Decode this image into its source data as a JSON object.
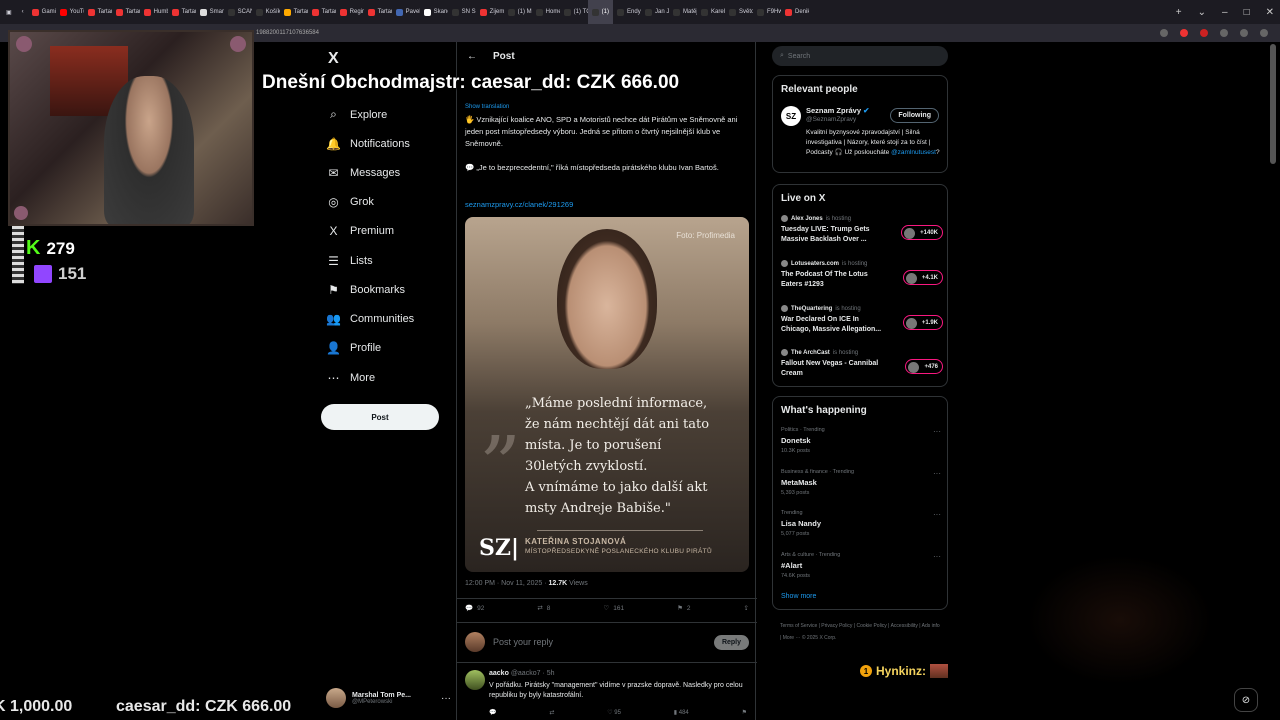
{
  "browser": {
    "tabs": [
      {
        "label": "Gami",
        "color": "#e33"
      },
      {
        "label": "YouTu",
        "color": "#f00"
      },
      {
        "label": "Tartar",
        "color": "#e33"
      },
      {
        "label": "Tartar",
        "color": "#e33"
      },
      {
        "label": "Humb",
        "color": "#e33"
      },
      {
        "label": "Tartar",
        "color": "#e33"
      },
      {
        "label": "Smart",
        "color": "#ddd"
      },
      {
        "label": "SCAN",
        "color": "#333"
      },
      {
        "label": "Košík",
        "color": "#333"
      },
      {
        "label": "Tartar",
        "color": "#fa0"
      },
      {
        "label": "Tartar",
        "color": "#e33"
      },
      {
        "label": "Regim",
        "color": "#e33"
      },
      {
        "label": "Tartar",
        "color": "#e33"
      },
      {
        "label": "Pavel",
        "color": "#4267b2"
      },
      {
        "label": "Skand",
        "color": "#fff"
      },
      {
        "label": "SN Sném",
        "color": "#333"
      },
      {
        "label": "Zijem",
        "color": "#e33"
      },
      {
        "label": "(1) Mi",
        "color": "#333"
      },
      {
        "label": "Home",
        "color": "#333"
      },
      {
        "label": "(1) TC",
        "color": "#333"
      },
      {
        "label": "(1)",
        "color": "#333",
        "active": true
      },
      {
        "label": "Endyr",
        "color": "#333"
      },
      {
        "label": "Jan Ja",
        "color": "#333"
      },
      {
        "label": "Matěj",
        "color": "#333"
      },
      {
        "label": "Karel",
        "color": "#333"
      },
      {
        "label": "Světo",
        "color": "#333"
      },
      {
        "label": "F9Hw",
        "color": "#333"
      },
      {
        "label": "Denik",
        "color": "#e33"
      }
    ],
    "url_fragment": "1988200117107636584"
  },
  "nav": {
    "logo": "X",
    "items": [
      {
        "label": "Explore",
        "icon": "search-icon",
        "glyph": "⌕"
      },
      {
        "label": "Notifications",
        "icon": "bell-icon",
        "glyph": "🔔"
      },
      {
        "label": "Messages",
        "icon": "envelope-icon",
        "glyph": "✉"
      },
      {
        "label": "Grok",
        "icon": "grok-icon",
        "glyph": "◎"
      },
      {
        "label": "Premium",
        "icon": "x-premium-icon",
        "glyph": "X"
      },
      {
        "label": "Lists",
        "icon": "list-icon",
        "glyph": "☰"
      },
      {
        "label": "Bookmarks",
        "icon": "bookmark-icon",
        "glyph": "⚑"
      },
      {
        "label": "Communities",
        "icon": "people-icon",
        "glyph": "👥"
      },
      {
        "label": "Profile",
        "icon": "person-icon",
        "glyph": "👤"
      },
      {
        "label": "More",
        "icon": "more-circle-icon",
        "glyph": "⋯"
      }
    ],
    "post_button": "Post",
    "account": {
      "name": "Marshal Tom Pe...",
      "handle": "@MPeterowski"
    }
  },
  "post": {
    "header": "Post",
    "show_translation": "Show translation",
    "text": "🖐 Vznikající koalice ANO, SPD a Motoristů nechce dát Pirátům ve Sněmovně ani jeden post místopředsedy výboru. Jedná se přitom o čtvrtý nejsilnější klub ve Sněmovně.\n\n💬 „Je to bezprecedentní,\" říká místopředseda pirátského klubu Ivan Bartoš.",
    "link": "seznamzpravy.cz/clanek/291269",
    "media": {
      "photo_credit": "Foto: Profimedia",
      "quote": "„Máme poslední informace,\nže nám nechtějí dát ani tato\nmísta. Je to porušení\n30letých zvyklostí.\nA vnímáme to jako další akt\nmsty Andreje Babiše.\"",
      "brand": "SZ|",
      "author": "KATEŘINA STOJANOVÁ",
      "role": "MÍSTOPŘEDSEDKYNĚ POSLANECKÉHO KLUBU PIRÁTŮ"
    },
    "time": "12:00 PM · Nov 11, 2025 · ",
    "views": "12.7K",
    "views_label": " Views",
    "actions": {
      "replies": "92",
      "reposts": "8",
      "likes": "161",
      "bookmarks": "2"
    },
    "reply_placeholder": "Post your reply",
    "reply_button": "Reply"
  },
  "reply": {
    "name": "aacko",
    "handle": "@aacko7 · 5h",
    "text": "V pořádku. Pirátsky \"management\" vidíme v prazske dopravě. Nasledky pro celou republiku by byly katastrofální.",
    "likes": "95",
    "views": "484"
  },
  "sidebar": {
    "search_placeholder": "Search",
    "relevant_title": "Relevant people",
    "relevant": {
      "logo": "SZ",
      "name": "Seznam Zprávy",
      "handle": "@SeznamZpravy",
      "follow": "Following",
      "bio": "Kvalitní byznysové zpravodajství | Silná investigativa | Názory, které stojí za to číst | Podcasty 🎧 Už posloucháte ",
      "bio_link": "@zamlnutusest",
      "bio_end": "?"
    },
    "live_title": "Live on X",
    "live": [
      {
        "host": "Alex Jones",
        "status": "is hosting",
        "title": "Tuesday LIVE: Trump Gets Massive Backlash Over ...",
        "count": "+140K"
      },
      {
        "host": "Lotuseaters.com",
        "status": "is hosting",
        "title": "The Podcast Of The Lotus Eaters #1293",
        "count": "+4.1K"
      },
      {
        "host": "TheQuartering",
        "status": "is hosting",
        "title": "War Declared On ICE In Chicago, Massive Allegation...",
        "count": "+1.9K"
      },
      {
        "host": "The ArchCast",
        "status": "is hosting",
        "title": "Fallout New Vegas - Cannibal Cream",
        "count": "+476"
      }
    ],
    "happening_title": "What's happening",
    "trends": [
      {
        "category": "Politics · Trending",
        "name": "Donetsk",
        "count": "10.3K posts"
      },
      {
        "category": "Business & finance · Trending",
        "name": "MetaMask",
        "count": "5,393 posts"
      },
      {
        "category": "Trending",
        "name": "Lisa Nandy",
        "count": "5,077 posts"
      },
      {
        "category": "Arts & culture · Trending",
        "name": "#Alart",
        "count": "74.6K posts"
      }
    ],
    "show_more": "Show more",
    "footer": "Terms of Service  |  Privacy Policy  |  Cookie Policy  |  Accessibility  |  Ads info  |  More ···  © 2025 X Corp."
  },
  "overlay": {
    "banner": "Dnešní Obchodmajstr: caesar_dd: CZK 666.00",
    "kick_count": "279",
    "twitch_count": "151",
    "ticker_left": "K 1,000.00",
    "ticker_right": "caesar_dd: CZK 666.00",
    "chat_user": "Hynkinz:",
    "chat_badge": "1"
  }
}
